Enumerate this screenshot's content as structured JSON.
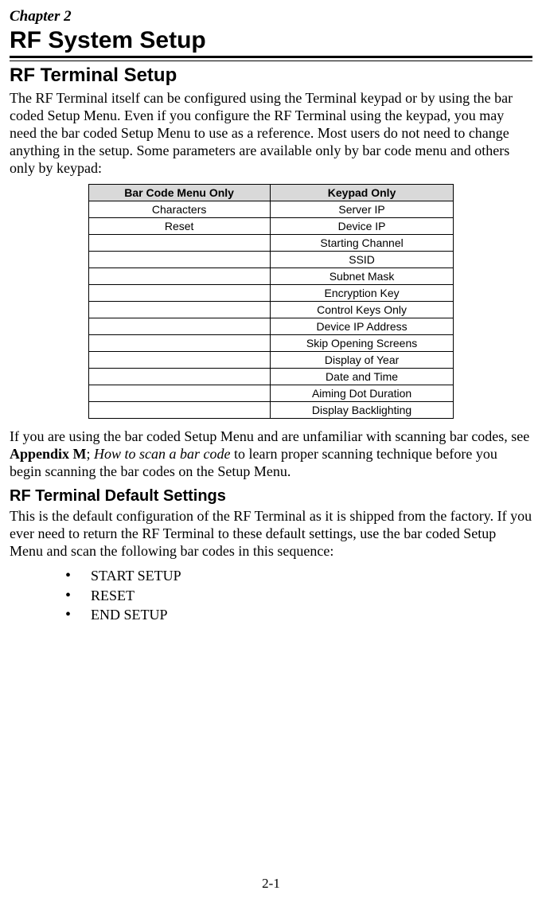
{
  "chapter_label": "Chapter 2",
  "title": "RF System Setup",
  "section1_title": "RF Terminal Setup",
  "intro_para": "The RF Terminal itself can be configured using the Terminal keypad or by using the bar coded Setup Menu. Even if you configure the RF Terminal using the keypad, you may need the bar coded Setup Menu to use as a reference.  Most users do not need to change anything in the setup.  Some parameters are available only by bar code menu and others only by keypad:",
  "table": {
    "headers": [
      "Bar Code Menu Only",
      "Keypad Only"
    ],
    "rows": [
      [
        "Characters",
        "Server IP"
      ],
      [
        "Reset",
        "Device IP"
      ],
      [
        "",
        "Starting Channel"
      ],
      [
        "",
        "SSID"
      ],
      [
        "",
        "Subnet Mask"
      ],
      [
        "",
        "Encryption Key"
      ],
      [
        "",
        "Control Keys Only"
      ],
      [
        "",
        "Device IP Address"
      ],
      [
        "",
        "Skip Opening Screens"
      ],
      [
        "",
        "Display of Year"
      ],
      [
        "",
        "Date and Time"
      ],
      [
        "",
        "Aiming Dot Duration"
      ],
      [
        "",
        "Display Backlighting"
      ]
    ]
  },
  "post_table": {
    "pre": "If you are using the bar coded Setup Menu and are unfamiliar with scanning bar codes, see ",
    "bold": "Appendix M",
    "sep": "; ",
    "italic": "How to scan a bar code",
    "post": " to learn proper scanning technique before you begin scanning the bar codes on the Setup Menu."
  },
  "section2_title": "RF Terminal Default Settings",
  "defaults_para": "This is the default configuration of the RF Terminal as it is shipped from the factory.  If you ever need to return the RF Terminal to these default settings, use the bar coded Setup Menu and scan the following bar codes in this sequence:",
  "bullets": [
    "START SETUP",
    "RESET",
    "END SETUP"
  ],
  "page_number": "2-1"
}
